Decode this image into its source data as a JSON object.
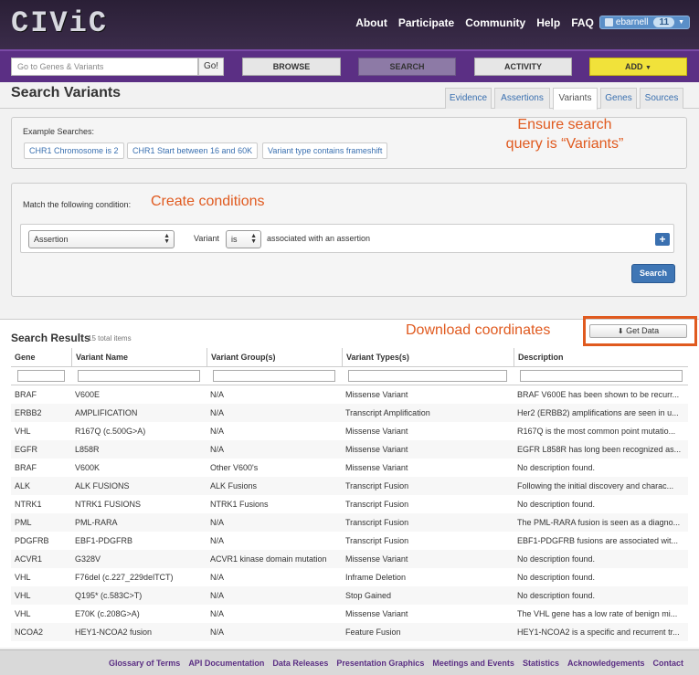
{
  "header": {
    "logo": "CIViC",
    "nav": [
      "About",
      "Participate",
      "Community",
      "Help",
      "FAQ"
    ],
    "user": {
      "name": "ebarnell",
      "notifications": "11"
    }
  },
  "navbar": {
    "search_placeholder": "Go to Genes & Variants",
    "go_label": "Go!",
    "browse_label": "BROWSE",
    "search_label": "SEARCH",
    "activity_label": "ACTIVITY",
    "add_label": "ADD"
  },
  "page": {
    "title": "Search Variants",
    "tabs": [
      "Evidence",
      "Assertions",
      "Variants",
      "Genes",
      "Sources"
    ],
    "active_tab": "Variants"
  },
  "examples": {
    "label": "Example Searches:",
    "items": [
      "CHR1 Chromosome is 2",
      "CHR1 Start between 16 and 60K",
      "Variant type contains frameshift"
    ],
    "annotation_line1": "Ensure search",
    "annotation_line2": "query is “Variants”"
  },
  "conditions": {
    "label": "Match the following condition:",
    "annotation": "Create conditions",
    "field_select": "Assertion",
    "subject_label": "Variant",
    "operator_select": "is",
    "value_text": "associated with an assertion",
    "add_label": "+",
    "search_button": "Search"
  },
  "results": {
    "title": "Search Results",
    "count": "15 total items",
    "annotation": "Download coordinates",
    "get_data_label": "Get Data",
    "columns": [
      "Gene",
      "Variant Name",
      "Variant Group(s)",
      "Variant Types(s)",
      "Description"
    ],
    "rows": [
      [
        "BRAF",
        "V600E",
        "N/A",
        "Missense Variant",
        "BRAF V600E has been shown to be recurr..."
      ],
      [
        "ERBB2",
        "AMPLIFICATION",
        "N/A",
        "Transcript Amplification",
        "Her2 (ERBB2) amplifications are seen in u..."
      ],
      [
        "VHL",
        "R167Q (c.500G>A)",
        "N/A",
        "Missense Variant",
        "R167Q is the most common point mutatio..."
      ],
      [
        "EGFR",
        "L858R",
        "N/A",
        "Missense Variant",
        "EGFR L858R has long been recognized as..."
      ],
      [
        "BRAF",
        "V600K",
        "Other V600's",
        "Missense Variant",
        "No description found."
      ],
      [
        "ALK",
        "ALK FUSIONS",
        "ALK Fusions",
        "Transcript Fusion",
        "Following the initial discovery and charac..."
      ],
      [
        "NTRK1",
        "NTRK1 FUSIONS",
        "NTRK1 Fusions",
        "Transcript Fusion",
        "No description found."
      ],
      [
        "PML",
        "PML-RARA",
        "N/A",
        "Transcript Fusion",
        "The PML-RARA fusion is seen as a diagno..."
      ],
      [
        "PDGFRB",
        "EBF1-PDGFRB",
        "N/A",
        "Transcript Fusion",
        "EBF1-PDGFRB fusions are associated wit..."
      ],
      [
        "ACVR1",
        "G328V",
        "ACVR1 kinase domain mutation",
        "Missense Variant",
        "No description found."
      ],
      [
        "VHL",
        "F76del (c.227_229delTCT)",
        "N/A",
        "Inframe Deletion",
        "No description found."
      ],
      [
        "VHL",
        "Q195* (c.583C>T)",
        "N/A",
        "Stop Gained",
        "No description found."
      ],
      [
        "VHL",
        "E70K (c.208G>A)",
        "N/A",
        "Missense Variant",
        "The VHL gene has a low rate of benign mi..."
      ],
      [
        "NCOA2",
        "HEY1-NCOA2 fusion",
        "N/A",
        "Feature Fusion",
        "HEY1-NCOA2 is a specific and recurrent tr..."
      ]
    ]
  },
  "footer": {
    "links": [
      "Glossary of Terms",
      "API Documentation",
      "Data Releases",
      "Presentation Graphics",
      "Meetings and Events",
      "Statistics",
      "Acknowledgements",
      "Contact"
    ]
  },
  "colors": {
    "brand_purple": "#5b2f84",
    "accent_orange": "#e05a1f",
    "add_yellow": "#f1e23a",
    "link_blue": "#3a70b0"
  }
}
